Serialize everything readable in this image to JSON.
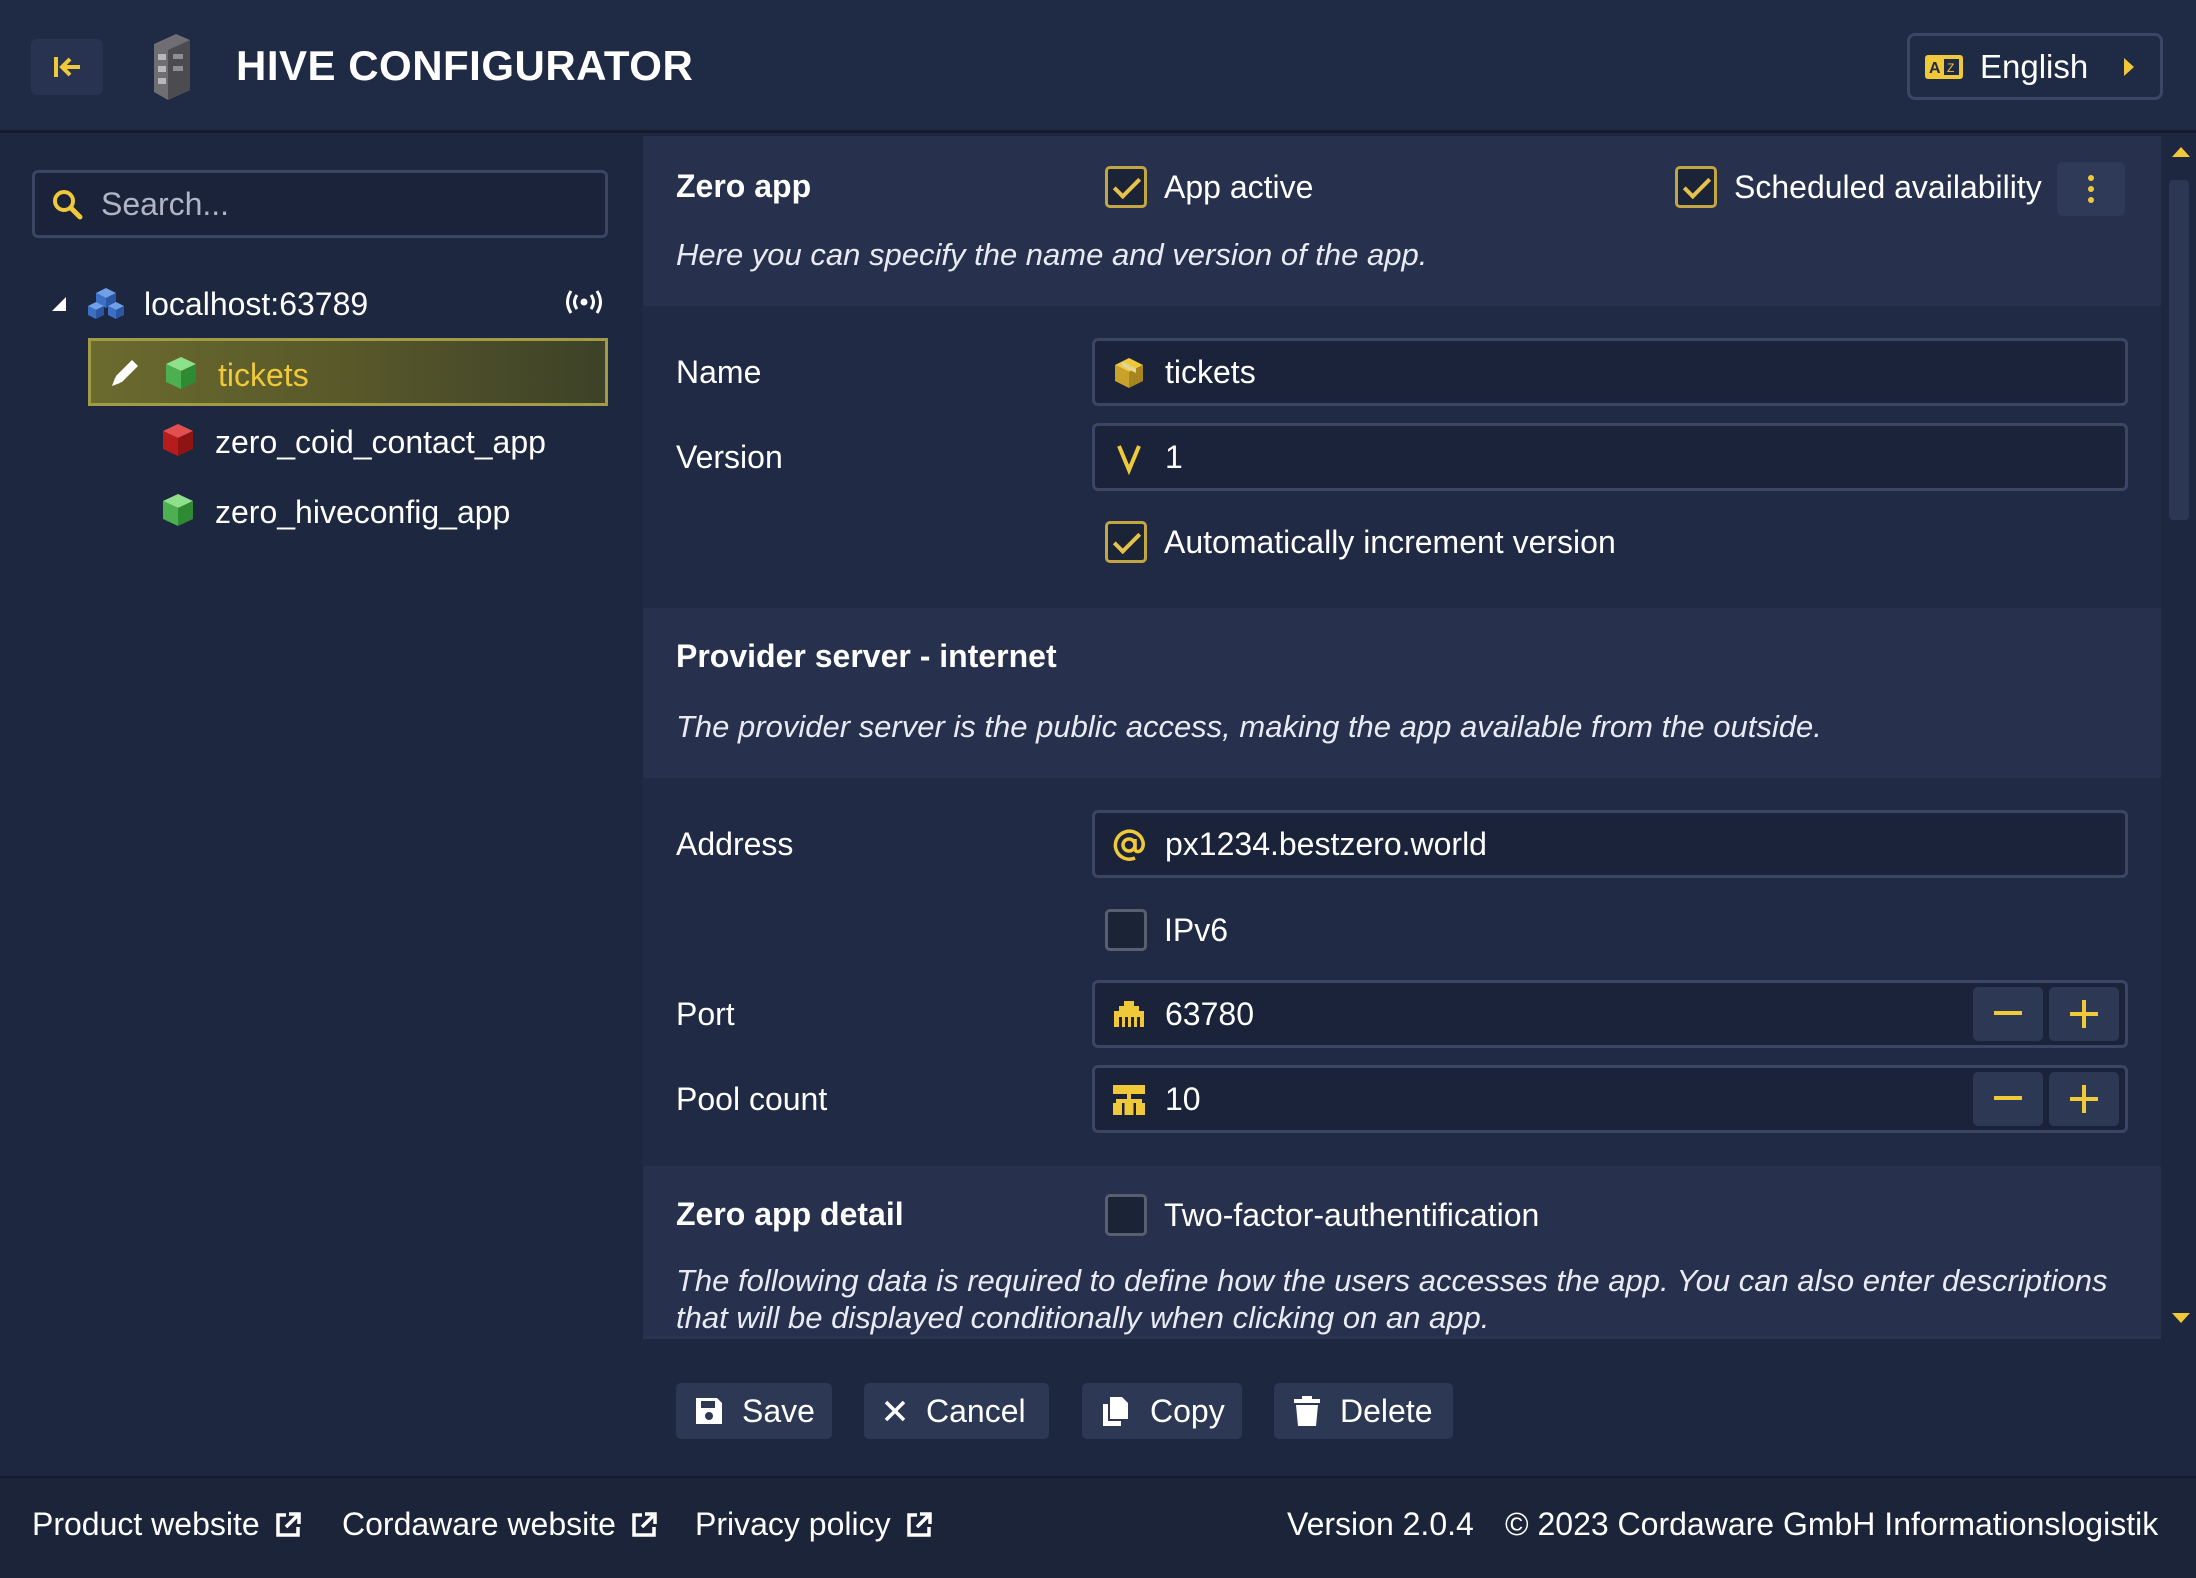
{
  "header": {
    "title": "HIVE CONFIGURATOR",
    "language": "English"
  },
  "sidebar": {
    "search_placeholder": "Search...",
    "server": "localhost:63789",
    "apps": [
      {
        "label": "tickets",
        "selected": true,
        "color": "#4caf50"
      },
      {
        "label": "zero_coid_contact_app",
        "selected": false,
        "color": "#c62828"
      },
      {
        "label": "zero_hiveconfig_app",
        "selected": false,
        "color": "#4caf50"
      }
    ]
  },
  "zero_app": {
    "title": "Zero app",
    "app_active_label": "App active",
    "app_active": true,
    "scheduled_label": "Scheduled availability",
    "scheduled": true,
    "description": "Here you can specify the name and version of the app.",
    "name_label": "Name",
    "name_value": "tickets",
    "version_label": "Version",
    "version_value": "1",
    "auto_increment_label": "Automatically increment version",
    "auto_increment": true
  },
  "provider": {
    "title": "Provider server - internet",
    "description": "The provider server is the public access, making the app available from the outside.",
    "address_label": "Address",
    "address_value": "px1234.bestzero.world",
    "ipv6_label": "IPv6",
    "ipv6": false,
    "port_label": "Port",
    "port_value": "63780",
    "pool_label": "Pool count",
    "pool_value": "10"
  },
  "detail": {
    "title": "Zero app detail",
    "two_factor_label": "Two-factor-authentification",
    "two_factor": false,
    "description": "The following data is required to define how the users accesses the app. You can also enter descriptions that will be displayed conditionally when clicking on an app."
  },
  "actions": {
    "save": "Save",
    "cancel": "Cancel",
    "copy": "Copy",
    "delete": "Delete"
  },
  "footer": {
    "product_website": "Product website",
    "cordaware_website": "Cordaware website",
    "privacy_policy": "Privacy policy",
    "version": "Version 2.0.4",
    "copyright": "© 2023 Cordaware GmbH Informationslogistik"
  },
  "colors": {
    "accent": "#f0c93a",
    "background": "#1d2740",
    "panel": "#27314e"
  }
}
